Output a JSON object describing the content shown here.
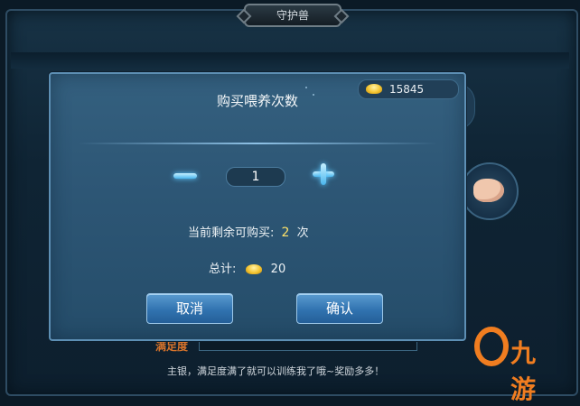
{
  "background": {
    "window_title": "守护兽",
    "satiety_label": "满足度",
    "hint_text": "主银，满足度满了就可以训练我了哦~奖励多多！"
  },
  "dialog": {
    "title": "购买喂养次数",
    "gold_balance": "15845",
    "quantity": "1",
    "remaining_prefix": "当前剩余可购买:",
    "remaining_count": "2",
    "remaining_suffix": "次",
    "total_label": "总计:",
    "total_cost": "20",
    "cancel_label": "取消",
    "confirm_label": "确认"
  },
  "watermark": {
    "text": "九游"
  },
  "colors": {
    "accent_gold": "#f4c430",
    "count_highlight": "#ffe36a",
    "button_blue": "#3173b0",
    "watermark_orange": "#f07d20",
    "satiety_orange": "#d9742b"
  },
  "icons": {
    "currency": "gold-ingot-icon",
    "decrease": "minus-icon",
    "increase": "plus-icon"
  }
}
